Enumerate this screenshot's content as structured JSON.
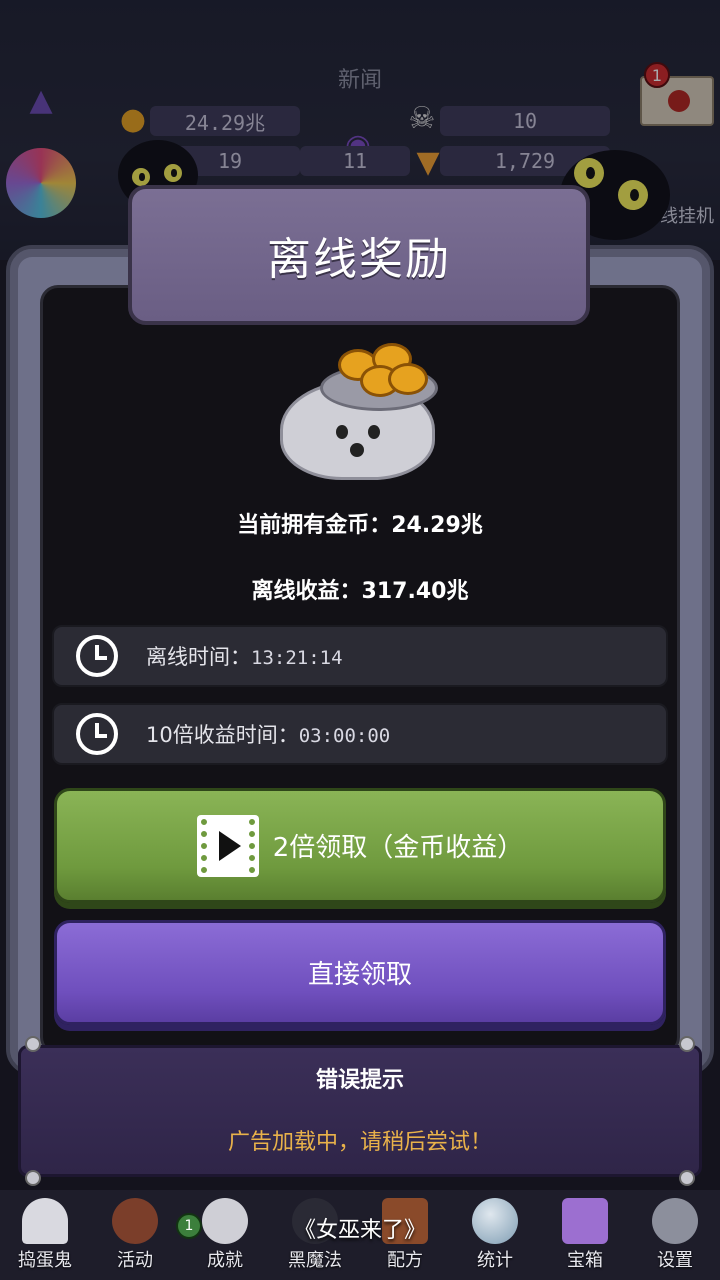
{
  "hud": {
    "news": "新闻",
    "stats": [
      "24.29兆",
      "10",
      "19",
      "11",
      "1,729"
    ],
    "mail_badge": "1",
    "idle_label": "线挂机"
  },
  "dialog": {
    "title": "离线奖励",
    "current_coins": "当前拥有金币：24.29兆",
    "offline_income": "离线收益：317.40兆",
    "offline_time_label": "离线时间：",
    "offline_time_value": "13:21:14",
    "boost_time_label": "10倍收益时间：",
    "boost_time_value": "03:00:00",
    "double_claim": "2倍领取（金币收益）",
    "direct_claim": "直接领取"
  },
  "toast": {
    "title": "错误提示",
    "message": "广告加载中，请稍后尝试！"
  },
  "nav": {
    "items": [
      "捣蛋鬼",
      "活动",
      "成就",
      "黑魔法",
      "配方",
      "统计",
      "宝箱",
      "设置"
    ],
    "badge": "1",
    "banner": "《女巫来了》"
  },
  "colors": {
    "accent_green": "#6f9a3e",
    "accent_purple": "#6f4fbd",
    "warning_text": "#e9b24a"
  }
}
